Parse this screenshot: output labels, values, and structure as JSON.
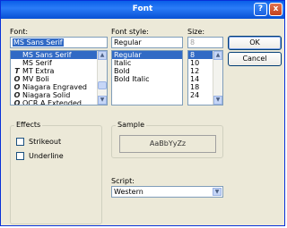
{
  "window": {
    "title": "Font"
  },
  "titlebar": {
    "help_label": "?",
    "close_label": "x"
  },
  "font": {
    "label": "Font:",
    "value": "MS Sans Serif",
    "items": [
      {
        "name": "MS Sans Serif",
        "icon": ""
      },
      {
        "name": "MS Serif",
        "icon": ""
      },
      {
        "name": "MT Extra",
        "icon": "truetype-icon"
      },
      {
        "name": "MV Boli",
        "icon": "opentype-icon"
      },
      {
        "name": "Niagara Engraved",
        "icon": "opentype-icon"
      },
      {
        "name": "Niagara Solid",
        "icon": "opentype-icon"
      },
      {
        "name": "OCR A Extended",
        "icon": "opentype-icon"
      }
    ]
  },
  "style": {
    "label": "Font style:",
    "value": "Regular",
    "items": [
      "Regular",
      "Italic",
      "Bold",
      "Bold Italic"
    ]
  },
  "size": {
    "label": "Size:",
    "value": "8",
    "items": [
      "8",
      "10",
      "12",
      "14",
      "18",
      "24"
    ]
  },
  "buttons": {
    "ok": "OK",
    "cancel": "Cancel"
  },
  "effects": {
    "label": "Effects",
    "strikeout": "Strikeout",
    "underline": "Underline"
  },
  "sample": {
    "label": "Sample",
    "text": "AaBbYyZz"
  },
  "script": {
    "label": "Script:",
    "value": "Western"
  },
  "colors": {
    "selection": "#316ac5",
    "titlebar": "#0a5ee8",
    "face": "#ece9d8"
  }
}
